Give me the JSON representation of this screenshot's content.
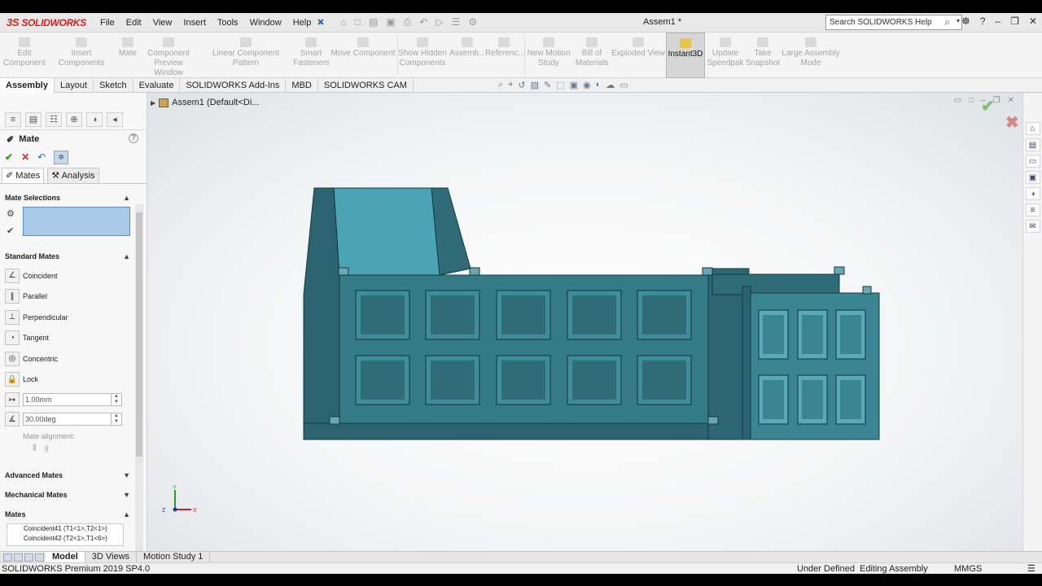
{
  "app": {
    "brand": "SOLIDWORKS",
    "document_title": "Assem1 *",
    "menus": [
      "File",
      "Edit",
      "View",
      "Insert",
      "Tools",
      "Window",
      "Help"
    ],
    "search_placeholder": "Search SOLIDWORKS Help"
  },
  "command_manager": [
    {
      "label": "Edit\nComponent",
      "enabled": false
    },
    {
      "label": "Insert Components",
      "enabled": false
    },
    {
      "label": "Mate",
      "enabled": false
    },
    {
      "label": "Component\nPreview Window",
      "enabled": false
    },
    {
      "label": "Linear Component Pattern",
      "enabled": false
    },
    {
      "label": "Smart\nFasteners",
      "enabled": false
    },
    {
      "label": "Move Component",
      "enabled": false
    },
    {
      "label": "Show Hidden\nComponents",
      "enabled": false
    },
    {
      "label": "Assemb...",
      "enabled": false
    },
    {
      "label": "Referenc...",
      "enabled": false
    },
    {
      "label": "New Motion\nStudy",
      "enabled": false
    },
    {
      "label": "Bill of\nMaterials",
      "enabled": false
    },
    {
      "label": "Exploded View",
      "enabled": false
    },
    {
      "label": "Instant3D",
      "enabled": true
    },
    {
      "label": "Update\nSpeedpak",
      "enabled": false
    },
    {
      "label": "Take\nSnapshot",
      "enabled": false
    },
    {
      "label": "Large Assembly\nMode",
      "enabled": false
    }
  ],
  "tabs": [
    {
      "label": "Assembly",
      "active": true
    },
    {
      "label": "Layout",
      "active": false
    },
    {
      "label": "Sketch",
      "active": false
    },
    {
      "label": "Evaluate",
      "active": false
    },
    {
      "label": "SOLIDWORKS Add-Ins",
      "active": false
    },
    {
      "label": "MBD",
      "active": false
    },
    {
      "label": "SOLIDWORKS CAM",
      "active": false
    }
  ],
  "property_manager": {
    "title": "Mate",
    "subtabs": {
      "mates": "Mates",
      "analysis": "Analysis"
    },
    "sections": {
      "mate_selections": "Mate Selections",
      "standard_mates": "Standard Mates",
      "advanced_mates": "Advanced Mates",
      "mechanical_mates": "Mechanical Mates",
      "mates": "Mates"
    },
    "standard_mates": [
      "Coincident",
      "Parallel",
      "Perpendicular",
      "Tangent",
      "Concentric",
      "Lock"
    ],
    "distance_value": "1.00mm",
    "angle_value": "30.00deg",
    "mate_alignment_label": "Mate alignment:",
    "mates_list": [
      "Coincident41 (T1<1>,T2<1>)",
      "Coincident42 (T2<1>,T1<6>)"
    ]
  },
  "feature_tree": {
    "root": "Assem1  (Default<Di..."
  },
  "triad": {
    "y": "Y",
    "z": "Z",
    "x": "X"
  },
  "bottom_tabs": [
    {
      "label": "Model",
      "active": true
    },
    {
      "label": "3D Views",
      "active": false
    },
    {
      "label": "Motion Study 1",
      "active": false
    }
  ],
  "status": {
    "product": "SOLIDWORKS Premium 2019 SP4.0",
    "state": "Under Defined",
    "mode": "Editing Assembly",
    "units": "MMGS"
  },
  "colors": {
    "model_dark": "#2f6c78",
    "model_mid": "#3b8593",
    "model_light": "#4fa3b3",
    "selection": "#a9cbea",
    "brand_red": "#d3221e"
  }
}
